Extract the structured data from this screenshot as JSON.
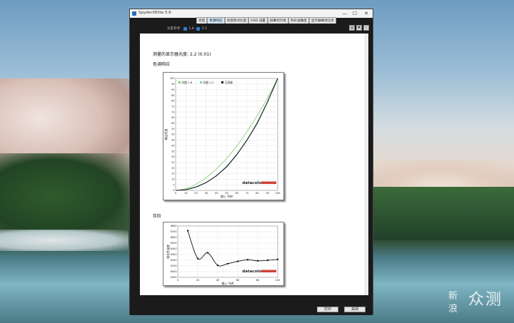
{
  "watermark": {
    "line1": "新",
    "line2": "浪",
    "big": "众测"
  },
  "window": {
    "title": "SpyderXElite 5.6",
    "controls": {
      "minimize": "—",
      "maximize": "☐",
      "close": "✕"
    },
    "tabs": [
      {
        "label": "亮度",
        "active": false
      },
      {
        "label": "色调响应",
        "active": true
      },
      {
        "label": "亮度和对比度",
        "active": false
      },
      {
        "label": "OSD 设置",
        "active": false
      },
      {
        "label": "屏幕均匀性",
        "active": false
      },
      {
        "label": "色彩准确度",
        "active": false
      },
      {
        "label": "显示器概述信息",
        "active": false
      }
    ],
    "ref": {
      "label": "光度参考:",
      "opt1": "1.8",
      "opt2": "2.2"
    },
    "tool_icons": [
      "print-preview-icon",
      "settings-icon",
      "zoom-icon"
    ],
    "measured_text": "测量的显示器光度: 2.2 (0.01)",
    "tone_label": "色调响应",
    "gray_label": "灰阶",
    "buttons": {
      "print": "打印",
      "close": "关闭"
    }
  },
  "chart_data": [
    {
      "type": "line",
      "title": "",
      "xlabel": "输入 %W",
      "ylabel": "输出亮度",
      "xlim": [
        0,
        100
      ],
      "ylim": [
        0,
        100
      ],
      "xticks": [
        0,
        10,
        20,
        30,
        40,
        50,
        60,
        70,
        80,
        90,
        100
      ],
      "yticks": [
        0,
        5,
        10,
        15,
        20,
        25,
        30,
        35,
        40,
        45,
        50,
        55,
        60,
        65,
        70,
        75,
        80,
        85,
        90,
        95,
        100
      ],
      "grid": true,
      "legend": "top-left",
      "series": [
        {
          "name": "光度 1.8",
          "color": "#7ccf6c",
          "gamma": 1.8
        },
        {
          "name": "光度 2.2",
          "color": "#6fd3d6",
          "gamma": 2.2
        },
        {
          "name": "已测量",
          "color": "#1a1a1a",
          "x": [
            0,
            10,
            20,
            30,
            40,
            50,
            60,
            70,
            80,
            90,
            100
          ],
          "y": [
            0,
            0.6,
            3,
            7,
            13,
            21,
            32,
            45,
            60,
            79,
            100
          ]
        }
      ],
      "logo": "datacolor"
    },
    {
      "type": "line",
      "title": "",
      "xlabel": "输入 %W",
      "ylabel": "相关色温度",
      "xlim": [
        0,
        100
      ],
      "ylim": [
        5900,
        6800
      ],
      "xticks": [
        0,
        20,
        40,
        60,
        80,
        100
      ],
      "yticks": [
        5900,
        6000,
        6100,
        6200,
        6300,
        6400,
        6500,
        6600,
        6700,
        6800
      ],
      "grid": true,
      "series": [
        {
          "name": "",
          "color": "#111111",
          "x": [
            10,
            20,
            30,
            40,
            50,
            60,
            70,
            80,
            90,
            100
          ],
          "y": [
            6720,
            6230,
            6330,
            6110,
            6140,
            6180,
            6210,
            6190,
            6200,
            6215
          ]
        }
      ],
      "logo": "datacolor"
    }
  ]
}
